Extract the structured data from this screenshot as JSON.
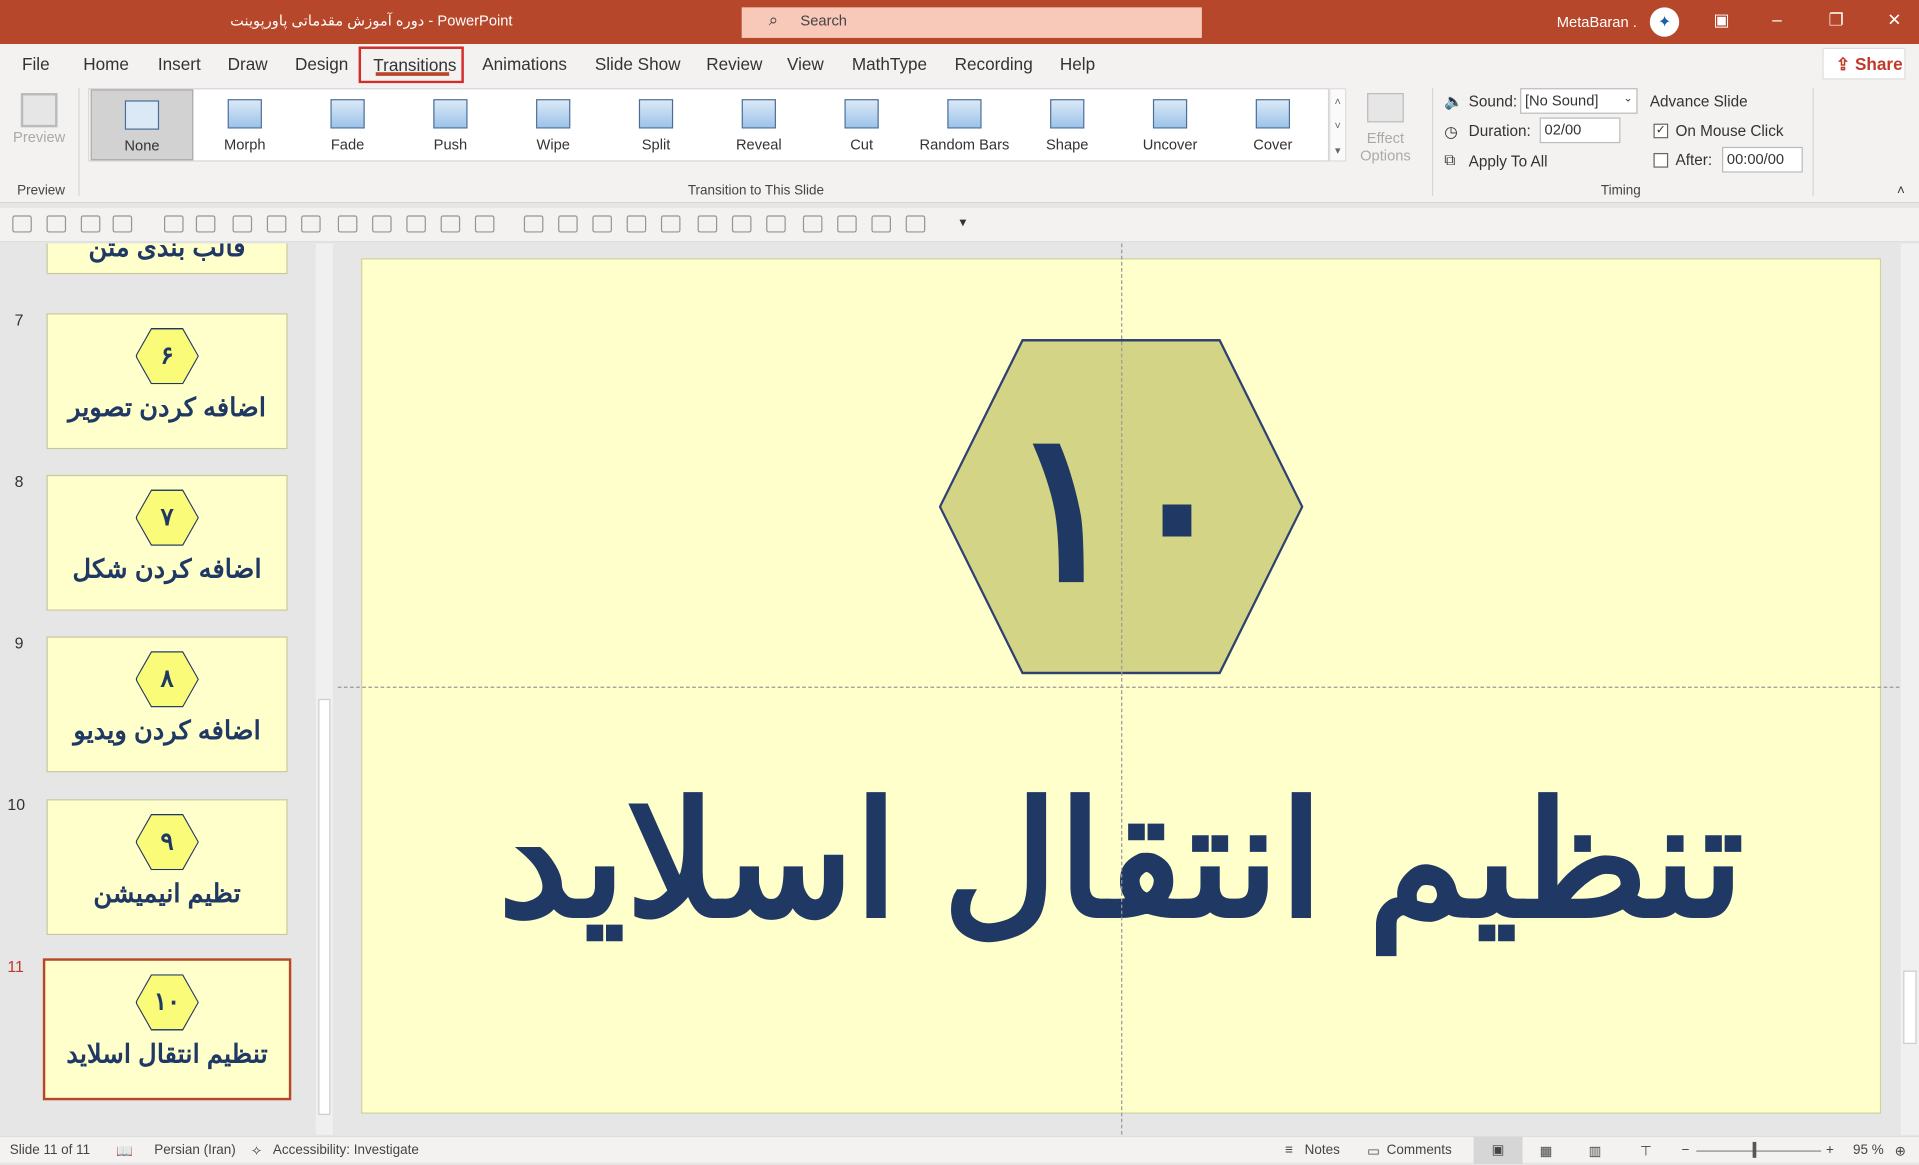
{
  "titlebar": {
    "doc_title": "دوره آموزش مقدماتی پاورپوینت  -  PowerPoint",
    "search_placeholder": "Search",
    "user": "MetaBaran .",
    "brand_color": "#b7472a"
  },
  "tabs": [
    "File",
    "Home",
    "Insert",
    "Draw",
    "Design",
    "Transitions",
    "Animations",
    "Slide Show",
    "Review",
    "View",
    "MathType",
    "Recording",
    "Help"
  ],
  "active_tab": "Transitions",
  "share_label": "Share",
  "ribbon": {
    "preview_label": "Preview",
    "preview_group": "Preview",
    "transitions": [
      "None",
      "Morph",
      "Fade",
      "Push",
      "Wipe",
      "Split",
      "Reveal",
      "Cut",
      "Random Bars",
      "Shape",
      "Uncover",
      "Cover"
    ],
    "selected_transition": "None",
    "effect_options": "Effect Options",
    "transition_group": "Transition to This Slide",
    "sound_label": "Sound:",
    "sound_value": "[No Sound]",
    "duration_label": "Duration:",
    "duration_value": "02/00",
    "apply_all": "Apply To All",
    "advance_label": "Advance Slide",
    "on_click_label": "On Mouse Click",
    "on_click_checked": true,
    "after_label": "After:",
    "after_value": "00:00/00",
    "after_checked": false,
    "timing_group": "Timing"
  },
  "thumbnails": [
    {
      "num": "",
      "badge": "",
      "title": "قالب بندی متن"
    },
    {
      "num": "7",
      "badge": "۶",
      "title": "اضافه کردن تصویر"
    },
    {
      "num": "8",
      "badge": "۷",
      "title": "اضافه کردن شکل"
    },
    {
      "num": "9",
      "badge": "۸",
      "title": "اضافه کردن ویدیو"
    },
    {
      "num": "10",
      "badge": "۹",
      "title": "تظیم انیمیشن"
    },
    {
      "num": "11",
      "badge": "۱۰",
      "title": "تنظیم انتقال اسلاید"
    }
  ],
  "slide": {
    "number": "۱۰",
    "title": "تنظیم انتقال اسلاید",
    "bg": "#ffffcc",
    "text_color": "#1f3864",
    "hex_color": "#d4d486"
  },
  "status": {
    "slide": "Slide 11 of 11",
    "language": "Persian (Iran)",
    "accessibility": "Accessibility: Investigate",
    "notes": "Notes",
    "comments": "Comments",
    "zoom": "95 %",
    "zoom_fraction": 0.45
  }
}
